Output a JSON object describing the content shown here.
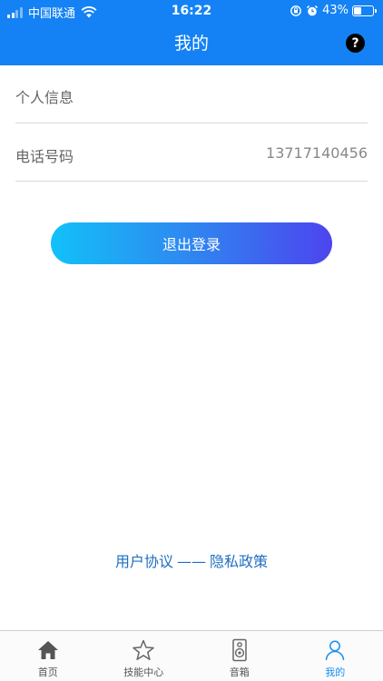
{
  "status_bar": {
    "carrier": "中国联通",
    "time": "16:22",
    "battery_percent": "43%",
    "battery_level": 0.43
  },
  "nav": {
    "title": "我的",
    "help_icon": "question-mark-circle-icon"
  },
  "profile": {
    "personal_info_label": "个人信息",
    "phone_label": "电话号码",
    "phone_value": "13717140456"
  },
  "logout_label": "退出登录",
  "agreements": {
    "user_agreement": "用户协议",
    "separator": "——",
    "privacy_policy": "隐私政策"
  },
  "tabbar": {
    "items": [
      {
        "label": "首页",
        "icon": "home-icon"
      },
      {
        "label": "技能中心",
        "icon": "star-icon"
      },
      {
        "label": "音箱",
        "icon": "speaker-icon"
      },
      {
        "label": "我的",
        "icon": "person-icon"
      }
    ],
    "active_index": 3
  },
  "colors": {
    "header_bg": "#1482f5",
    "gradient_start": "#12c1f8",
    "gradient_end": "#4d44ef",
    "link": "#1f6fc0",
    "tab_active": "#1a8ff0"
  }
}
